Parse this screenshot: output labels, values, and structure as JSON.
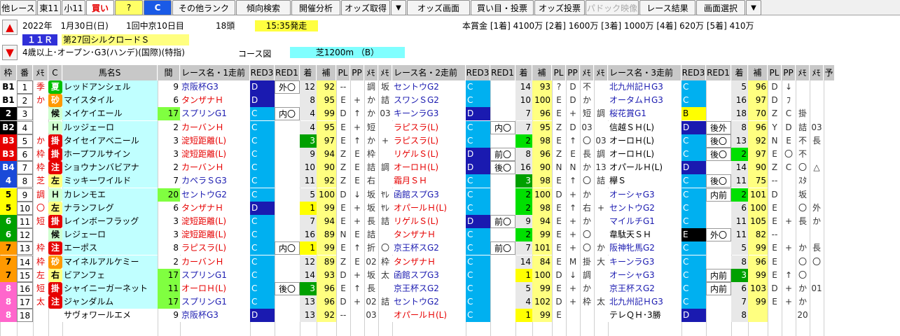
{
  "toolbar": [
    "他レース",
    "東11",
    "小11",
    "買い",
    "?",
    "C",
    "その他ランク",
    "傾向検索",
    "開催分析",
    "オッズ取得",
    "▼",
    "オッズ画面",
    "買い目・投票",
    "オッズ投票",
    "パドック映像",
    "レース結果",
    "画面選択",
    "▼"
  ],
  "race": {
    "date": "2022年　1月30日(日)",
    "meeting": "1回中京10日目",
    "heads": "18頭",
    "time": "15:35発走",
    "rnum": "１１Ｒ",
    "name": "第27回シルクロードＳ",
    "cond": "4歳以上･オープン･G3(ハンデ)(国際)(特指)",
    "course_label": "コース図",
    "course": "芝1200m （B）",
    "prize": "本賞金 [1着] 4100万 [2着] 1600万 [3着] 1000万 [4着] 620万 [5着] 410万"
  },
  "colors": {
    "frame": [
      "#ffffff",
      "#ffffff",
      "#ffffff",
      "#000000",
      "#000000",
      "#e60000",
      "#e60000",
      "#1a4ad8",
      "#1a4ad8",
      "#ffff00",
      "#ffff00",
      "#00a000",
      "#00a000",
      "#ff9900",
      "#ff9900",
      "#ff9900",
      "#ff66cc",
      "#ff66cc",
      "#ff66cc"
    ]
  },
  "headers": [
    "枠",
    "番",
    "ﾒﾓ",
    "C",
    "馬名S",
    "間",
    "レース名・1走前",
    "RED3",
    "RED1",
    "着",
    "補",
    "PL",
    "PP",
    "ﾒﾓ",
    "ﾒﾓ",
    "レース名・2走前",
    "RED3",
    "RED1",
    "着",
    "補",
    "PL",
    "PP",
    "ﾒﾓ",
    "ﾒﾓ",
    "レース名・3走前",
    "RED3",
    "RED1",
    "着",
    "補",
    "PL",
    "PP",
    "ﾒﾓ",
    "ﾒﾓ",
    "予"
  ],
  "rows": [
    [
      "B1",
      "1",
      "季",
      "夏",
      "レッドアンシェル",
      "9",
      "京阪杯G3",
      "D",
      "外〇",
      "12",
      "92",
      "--",
      "",
      "調",
      "坂",
      "セントウG2",
      "C",
      "",
      "14",
      "93",
      "?",
      "D",
      "不",
      "",
      "北九州記ＨG3",
      "C",
      "",
      "5",
      "96",
      "D",
      "↓",
      "",
      ""
    ],
    [
      "B1",
      "2",
      "か",
      "砂",
      "マイスタイル",
      "6",
      "タンザナＨ",
      "D",
      "",
      "8",
      "95",
      "E",
      "+",
      "か",
      "詰",
      "スワンＳG2",
      "C",
      "",
      "10",
      "100",
      "E",
      "D",
      "か",
      "",
      "オータムＨG3",
      "C",
      "",
      "16",
      "97",
      "D",
      "ﾌ",
      "",
      ""
    ],
    [
      "2",
      "3",
      "",
      "候",
      "メイケイエール",
      "17",
      "スプリンG1",
      "C",
      "内〇",
      "4",
      "99",
      "D",
      "↑",
      "か",
      "03",
      "キーンラG3",
      "D",
      "",
      "7",
      "96",
      "E",
      "+",
      "短",
      "調",
      "桜花賞G1",
      "B",
      "",
      "18",
      "70",
      "Z",
      "C",
      "掛",
      ""
    ],
    [
      "B2",
      "4",
      "",
      "Ｈ",
      "ルッジェーロ",
      "2",
      "カーバンＨ",
      "C",
      "",
      "4",
      "95",
      "E",
      "+",
      "短",
      "",
      "ラピスラ(L)",
      "C",
      "内〇",
      "7",
      "95",
      "Z",
      "D",
      "03",
      "",
      "信越ＳＨ(L)",
      "D",
      "後外",
      "8",
      "96",
      "Y",
      "D",
      "詰",
      "03"
    ],
    [
      "B3",
      "5",
      "か",
      "掛",
      "タイセイアベニール",
      "3",
      "淀短距離(L)",
      "C",
      "",
      "3",
      "97",
      "E",
      "↑",
      "か",
      "+",
      "ラピスラ(L)",
      "C",
      "",
      "2",
      "98",
      "E",
      "↑",
      "〇",
      "03",
      "オーロＨ(L)",
      "C",
      "後〇",
      "13",
      "92",
      "N",
      "E",
      "不",
      "長"
    ],
    [
      "B3",
      "6",
      "枠",
      "掛",
      "ホープフルサイン",
      "3",
      "淀短距離(L)",
      "C",
      "",
      "9",
      "94",
      "Z",
      "E",
      "枠",
      "",
      "リゲルＳ(L)",
      "D",
      "前〇",
      "8",
      "96",
      "Z",
      "E",
      "長",
      "調",
      "オーロＨ(L)",
      "C",
      "後〇",
      "2",
      "97",
      "E",
      "〇",
      "不",
      ""
    ],
    [
      "B4",
      "7",
      "枠",
      "注",
      "ショウナンバビアナ",
      "2",
      "カーバンＨ",
      "C",
      "",
      "10",
      "90",
      "Z",
      "E",
      "詰",
      "調",
      "オーロＨ(L)",
      "D",
      "後〇",
      "16",
      "90",
      "N",
      "N",
      "か",
      "13",
      "オパールＨ(L)",
      "D",
      "",
      "14",
      "90",
      "Z",
      "C",
      "〇",
      "△"
    ],
    [
      "4",
      "8",
      "芝",
      "左",
      "ミッキーワイルド",
      "7",
      "カペラＳG3",
      "C",
      "",
      "11",
      "92",
      "Z",
      "E",
      "右",
      "",
      "霜月ＳＨ",
      "C",
      "",
      "3",
      "98",
      "E",
      "↑",
      "〇",
      "詰",
      "欅Ｓ",
      "C",
      "後〇",
      "11",
      "75",
      "--",
      "",
      "ｽﾀ",
      ""
    ],
    [
      "5",
      "9",
      "調",
      "Ｈ",
      "カレンモエ",
      "20",
      "セントウG2",
      "C",
      "",
      "5",
      "100",
      "D",
      "↓",
      "坂",
      "ﾔﾚ",
      "函館スプG3",
      "C",
      "",
      "2",
      "100",
      "D",
      "+",
      "か",
      "",
      "オーシャG3",
      "C",
      "内前",
      "2",
      "101",
      "D",
      "",
      "坂",
      ""
    ],
    [
      "5",
      "10",
      "〇",
      "左",
      "ナランフレグ",
      "6",
      "タンザナＨ",
      "D",
      "",
      "1",
      "99",
      "E",
      "+",
      "坂",
      "ﾔﾚ",
      "オパールＨ(L)",
      "C",
      "",
      "2",
      "98",
      "E",
      "↑",
      "右",
      "+",
      "セントウG2",
      "C",
      "",
      "6",
      "100",
      "E",
      "",
      "〇",
      "外"
    ],
    [
      "6",
      "11",
      "短",
      "掛",
      "レインボーフラッグ",
      "3",
      "淀短距離(L)",
      "C",
      "",
      "7",
      "94",
      "E",
      "+",
      "長",
      "詰",
      "リゲルＳ(L)",
      "D",
      "前〇",
      "9",
      "94",
      "E",
      "+",
      "か",
      "",
      "マイルチG1",
      "C",
      "",
      "11",
      "105",
      "E",
      "+",
      "長",
      "か"
    ],
    [
      "6",
      "12",
      "",
      "候",
      "レジェーロ",
      "3",
      "淀短距離(L)",
      "C",
      "",
      "16",
      "89",
      "N",
      "E",
      "詰",
      "",
      "タンザナＨ",
      "C",
      "",
      "2",
      "99",
      "E",
      "+",
      "〇",
      "",
      "韋駄天ＳＨ",
      "E",
      "外〇",
      "11",
      "82",
      "--",
      "",
      "",
      ""
    ],
    [
      "7",
      "13",
      "枠",
      "注",
      "エーポス",
      "8",
      "ラピスラ(L)",
      "C",
      "内〇",
      "1",
      "99",
      "E",
      "↑",
      "折",
      "〇",
      "京王杯スG2",
      "C",
      "前〇",
      "7",
      "101",
      "E",
      "+",
      "〇",
      "か",
      "阪神牝馬G2",
      "C",
      "",
      "5",
      "99",
      "E",
      "+",
      "か",
      "長"
    ],
    [
      "7",
      "14",
      "枠",
      "砂",
      "マイネルアルケミー",
      "2",
      "カーバンＨ",
      "C",
      "",
      "12",
      "89",
      "Z",
      "E",
      "02",
      "枠",
      "タンザナＨ",
      "C",
      "",
      "14",
      "84",
      "E",
      "M",
      "掛",
      "大",
      "キーンラG3",
      "C",
      "",
      "8",
      "96",
      "E",
      "",
      "〇",
      "〇"
    ],
    [
      "7",
      "15",
      "左",
      "右",
      "ビアンフェ",
      "17",
      "スプリンG1",
      "C",
      "",
      "14",
      "93",
      "D",
      "+",
      "坂",
      "太",
      "函館スプG3",
      "C",
      "",
      "1",
      "100",
      "D",
      "↓",
      "調",
      "",
      "オーシャG3",
      "C",
      "内前",
      "3",
      "99",
      "E",
      "↑",
      "〇",
      ""
    ],
    [
      "8",
      "16",
      "短",
      "掛",
      "シャイニーガーネット",
      "11",
      "オーロＨ(L)",
      "C",
      "後〇",
      "3",
      "96",
      "E",
      "↑",
      "長",
      "",
      "京王杯スG2",
      "C",
      "",
      "5",
      "99",
      "E",
      "+",
      "か",
      "",
      "京王杯スG2",
      "C",
      "内前",
      "6",
      "103",
      "D",
      "+",
      "か",
      "01"
    ],
    [
      "8",
      "17",
      "太",
      "注",
      "ジャンダルム",
      "17",
      "スプリンG1",
      "C",
      "",
      "13",
      "96",
      "D",
      "+",
      "02",
      "詰",
      "セントウG2",
      "C",
      "",
      "4",
      "102",
      "D",
      "+",
      "枠",
      "太",
      "北九州記ＨG3",
      "C",
      "",
      "7",
      "99",
      "E",
      "+",
      "か",
      ""
    ],
    [
      "8",
      "18",
      "",
      "",
      "サヴォワールエメ",
      "9",
      "京阪杯G3",
      "D",
      "",
      "13",
      "92",
      "--",
      "",
      "03",
      "",
      "オパールＨ(L)",
      "C",
      "",
      "1",
      "99",
      "E",
      "",
      "",
      "",
      "テレＱＨ･3勝",
      "D",
      "",
      "8",
      "",
      "",
      "",
      "20",
      ""
    ]
  ]
}
